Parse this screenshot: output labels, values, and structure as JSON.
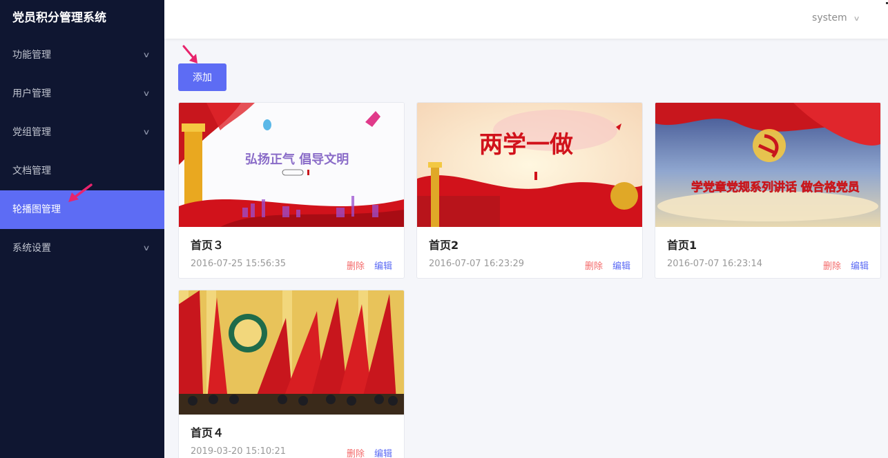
{
  "app": {
    "title": "党员积分管理系统"
  },
  "sidebar": {
    "items": [
      {
        "label": "功能管理",
        "has_children": true
      },
      {
        "label": "用户管理",
        "has_children": true
      },
      {
        "label": "党组管理",
        "has_children": true
      },
      {
        "label": "文档管理",
        "has_children": false
      },
      {
        "label": "轮播图管理",
        "has_children": false,
        "active": true
      },
      {
        "label": "系统设置",
        "has_children": true
      }
    ],
    "chevron": "chevron-down-icon"
  },
  "header": {
    "user": "system",
    "chevron": "chevron-down-icon"
  },
  "toolbar": {
    "add_label": "添加"
  },
  "cards": [
    {
      "title": "首页３",
      "date": "2016-07-25 15:56:35",
      "delete_label": "删除",
      "edit_label": "编辑",
      "banner_text": "弘扬正气 倡导文明"
    },
    {
      "title": "首页2",
      "date": "2016-07-07 16:23:29",
      "delete_label": "删除",
      "edit_label": "编辑",
      "banner_text": "两学一做"
    },
    {
      "title": "首页1",
      "date": "2016-07-07 16:23:14",
      "delete_label": "删除",
      "edit_label": "编辑",
      "banner_text": "学党章党规系列讲话 做合格党员"
    },
    {
      "title": "首页４",
      "date": "2019-03-20 15:10:21",
      "delete_label": "删除",
      "edit_label": "编辑",
      "banner_text": ""
    }
  ],
  "colors": {
    "sidebar_bg": "#0f1631",
    "accent": "#5d6cf4",
    "delete": "#f46a6a",
    "annotation_arrow": "#e8246c"
  }
}
